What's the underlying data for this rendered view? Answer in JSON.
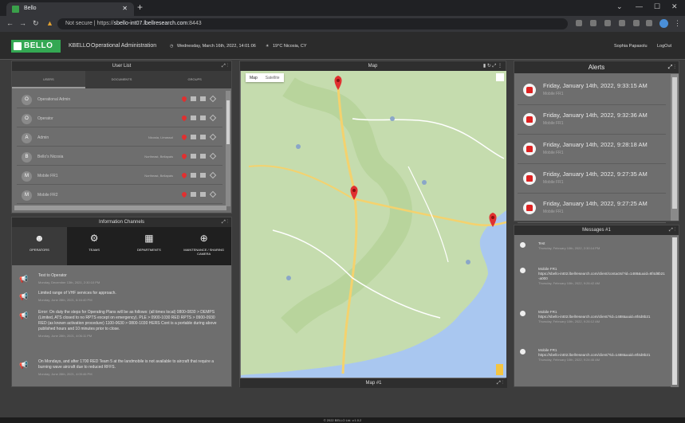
{
  "browser": {
    "tab_title": "Bello",
    "url_prefix": "Not secure | https://",
    "url_host": "sbello-int07.lbellresearch.com",
    "url_port": ":8443"
  },
  "header": {
    "logo": "BELLO",
    "app": "KBELLO",
    "section": "Operational Administration",
    "datetime": "Wednesday, March 16th, 2022, 14:01:06",
    "weather": "19°C Nicosia, CY",
    "user": "Sophia Papasolu",
    "logout": "LogOut"
  },
  "userlist": {
    "title": "User List",
    "tabs": [
      "USERS",
      "DOCUMENTS",
      "GROUPS"
    ],
    "users": [
      {
        "initial": "O",
        "name": "Operational Admin",
        "loc": ""
      },
      {
        "initial": "O",
        "name": "Operator",
        "loc": ""
      },
      {
        "initial": "A",
        "name": "Admin",
        "loc": "Nicosia, Limassol"
      },
      {
        "initial": "B",
        "name": "Bello's Nicosia",
        "loc": "Northeast, Bellapais"
      },
      {
        "initial": "M",
        "name": "Mobile FR1",
        "loc": "Northeast, Bellapais"
      },
      {
        "initial": "M",
        "name": "Mobile FR2",
        "loc": ""
      }
    ]
  },
  "channels": {
    "title": "Information Channels",
    "tabs": [
      {
        "icon": "☻",
        "label": "OPERATORS"
      },
      {
        "icon": "⚙",
        "label": "TEAMS"
      },
      {
        "icon": "▦",
        "label": "DEPARTMENTS"
      },
      {
        "icon": "⊕",
        "label": "MAINTENANCE / SHARING CAMERA"
      }
    ],
    "messages": [
      {
        "text": "Test to Operator",
        "date": "Monday, December 13th, 2021, 2:30:10 PM"
      },
      {
        "text": "Limited range of VHF services for approach.",
        "date": "Monday, June 28th, 2021, 6:16:40 PM"
      },
      {
        "text": "Error: On duty the steps for Operating Plans will be as follows: (all times local) 0800-0830 > DEMPS (Limited, ATS closed to no RPTS except on emergency). PLE > 0900-1030 RED RPTS > 0900-0930 RED (as known activation procedure) 1100-0630 > 0800-1030 HERS Cont is a portable during above published hours and 10 minutes prior to close.",
        "date": "Monday, June 28th, 2021, 4:06:11 PM"
      },
      {
        "text": "On Mondays, and after 1700 RED Team 5 at the landmobile is not available to aircraft that require a burning wave aircraft due to reduced RFFS.",
        "date": "Monday, June 28th, 2021, 4:05:46 PM"
      }
    ]
  },
  "map": {
    "title": "Map",
    "footer": "Map #1",
    "types": [
      "Map",
      "Satellite"
    ]
  },
  "alerts": {
    "title": "Alerts",
    "items": [
      {
        "time": "Friday, January 14th, 2022, 9:33:15 AM",
        "src": "Mobile FR1"
      },
      {
        "time": "Friday, January 14th, 2022, 9:32:36 AM",
        "src": "Mobile FR1"
      },
      {
        "time": "Friday, January 14th, 2022, 9:28:18 AM",
        "src": "Mobile FR1"
      },
      {
        "time": "Friday, January 14th, 2022, 9:27:35 AM",
        "src": "Mobile FR1"
      },
      {
        "time": "Friday, January 14th, 2022, 9:27:25 AM",
        "src": "Mobile FR1"
      }
    ]
  },
  "messages": {
    "title": "Messages #1",
    "items": [
      {
        "sender": "Test",
        "body": "",
        "time": "Thursday, February 10th, 2022, 2:30:14 PM"
      },
      {
        "sender": "Mobile FR1",
        "body": "https://sbello-int02.lbellresearch.com/client/contacts/?id=1488&uuid=8f4d8b21-a000",
        "time": "Thursday, February 10th, 2022, 9:26:42 AM"
      },
      {
        "sender": "Mobile FR1",
        "body": "https://sbello-int02.lbellresearch.com/client/?id=1488&uuid=8f4d8b21",
        "time": "Thursday, February 10th, 2022, 9:26:12 AM"
      },
      {
        "sender": "Mobile FR1",
        "body": "https://sbello-int02.lbellresearch.com/client/?id=1488&uuid=8f4d8b21",
        "time": "Thursday, February 10th, 2022, 9:24:46 AM"
      }
    ]
  },
  "footer": "© 2022 BELLO Ltd. v.1.0.2"
}
